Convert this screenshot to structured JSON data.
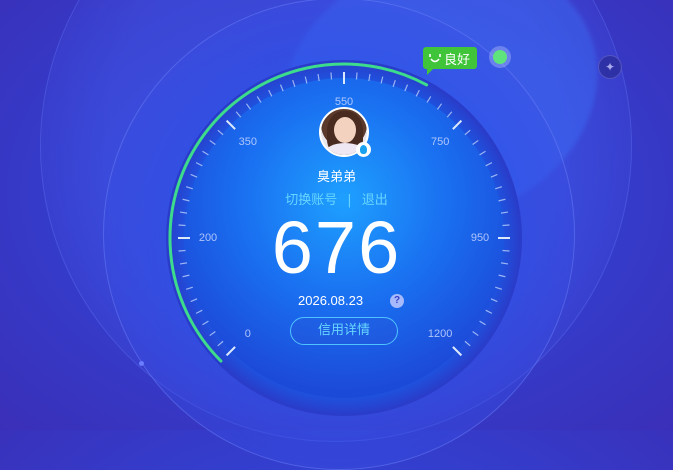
{
  "credit": {
    "score": "676",
    "rating_badge": "良好",
    "date": "2026.08.23",
    "scale_min": 0,
    "scale_max": 1200,
    "scale_labels": [
      "0",
      "200",
      "350",
      "550",
      "750",
      "950",
      "1200"
    ]
  },
  "user": {
    "name": "臭弟弟"
  },
  "links": {
    "switch_account": "切换账号",
    "separator": "|",
    "logout": "退出"
  },
  "buttons": {
    "detail": "信用详情",
    "help": "?"
  },
  "icons": {
    "badge": "smile-icon",
    "status": "status-dot-icon",
    "corner": "settings-icon",
    "avatar_badge": "qq-penguin-icon"
  },
  "colors": {
    "badge_green": "#3fc43a",
    "accent_cyan": "#67d6ff",
    "status_green": "#5ee37d",
    "progress_arc": "#3ddc8c"
  }
}
